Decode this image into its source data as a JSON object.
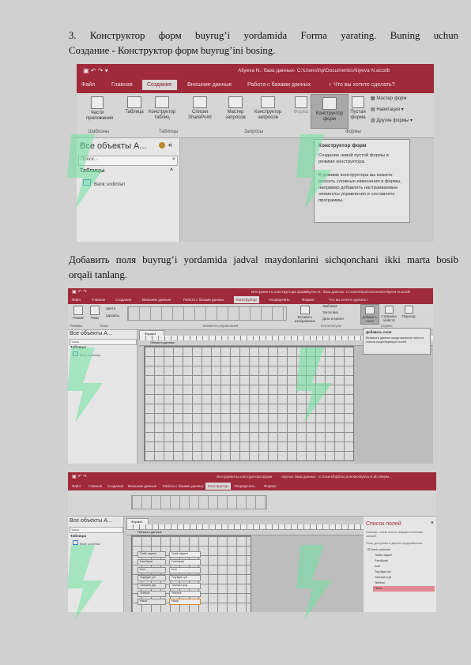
{
  "step": {
    "line1": "3.   Конструктор форм buyrug’i yordamida Forma yarating. Buning uchun",
    "line2": "Создание - Конструктор форм buyrug’ini bosing."
  },
  "step2": {
    "line1": "Добавить поля buyrug’i yordamida jadval maydonlarini sichqonchani ikki marta bosib",
    "line2": "orqali tanlang."
  },
  "shot1": {
    "title": "Aliyeva N.: база данных- C:\\Users\\hp\\Documents\\Aliyeva N.accdb",
    "tabs": [
      "Файл",
      "Главная",
      "Создание",
      "Внешние данные",
      "Работа с базами данных",
      "Что вы хотите сделать?"
    ],
    "buttons": {
      "parts": "Части приложения",
      "table": "Таблица",
      "table_design": "Конструктор таблиц",
      "sharepoint": "Списки SharePoint",
      "query_wizard": "Мастер запросов",
      "query_design": "Конструктор запросов",
      "form": "Форма",
      "form_design": "Конструктор форм",
      "blank_form": "Пустая форма",
      "form_wizard": "Мастер форм",
      "navigation": "Навигация",
      "other_forms": "Другие формы"
    },
    "groups": [
      "Шаблоны",
      "Таблицы",
      "Запросы",
      "Формы"
    ],
    "nav": {
      "header": "Все объекты А...",
      "search": "Поиск...",
      "section": "Таблицы",
      "item": "Bank sodimlari"
    },
    "tooltip": {
      "title": "Конструктор форм",
      "p1": "Создание новой пустой формы в режиме конструктора.",
      "p2": "В режиме конструктора вы можете вносить сложные изменения в формы, например добавлять настраиваемые элементы управления и составлять программы."
    }
  },
  "shot2": {
    "title": "Aliyeva N.: база данных- C:\\Users\\hp\\Documents\\Aliyeva N.accdb",
    "context": "Инструменты конструктора форм",
    "tabs": [
      "Файл",
      "Главная",
      "Создание",
      "Внешние данные",
      "Работа с базами данных",
      "Конструктор",
      "Упорядочить",
      "Формат",
      "Что вы хотите сделать?"
    ],
    "buttons": {
      "mode": "Режим",
      "themes": "Темы",
      "colors": "Цвета",
      "fonts": "Шрифты",
      "insert_image": "Вставить изображение",
      "logo": "Эмблема",
      "title_btn": "Заголовок",
      "datetime": "Дата и время",
      "add_fields": "Добавить поля",
      "prop_sheet": "Страница свойств",
      "tab_order": "Переход"
    },
    "groups": [
      "Режимы",
      "Темы",
      "Элементы управления",
      "Колонтитулы",
      "Сервис"
    ],
    "nav": {
      "header": "Все объекты А...",
      "search": "Поиск",
      "section": "Таблицы",
      "item": "Bank sodimlari"
    },
    "doc_tab": "Форма1",
    "section": "Область данных",
    "tooltip": {
      "title": "Добавить поля",
      "body": "Вставка в данное представление поля из списка существующих полей."
    }
  },
  "shot3": {
    "title": "Aliyeva: база данных - C:\\Users\\hp\\Documents\\Aliyeva N.db (Форм...",
    "context": "Инструменты конструктора форм",
    "tabs": [
      "Файл",
      "Главная",
      "Создание",
      "Внешние данные",
      "Работа с базами данных",
      "Конструктор",
      "Упорядочить",
      "Формат"
    ],
    "nav": {
      "header": "Все объекты А...",
      "search": "Поиск",
      "section": "Таблицы",
      "item": "Bank sodimlari"
    },
    "doc_tab": "Форма1",
    "section": "Область данных",
    "fields": [
      {
        "label": "Tartib raqami",
        "value": "Tartib raqami"
      },
      {
        "label": "Familiyasi",
        "value": "Familiyasi"
      },
      {
        "label": "Ismi",
        "value": "Ismi"
      },
      {
        "label": "Tug'ilgan yili",
        "value": "Tug'ilgan yili"
      },
      {
        "label": "Yashash joyi",
        "value": "Yashash joyi"
      },
      {
        "label": "Telefoni",
        "value": "Telefoni"
      },
      {
        "label": "Hisob",
        "value": "Hisob"
      }
    ],
    "panel": {
      "title": "Список полей",
      "hint": "Показать только поля в текущем источнике записей",
      "table_caption": "Поля, доступные в данном представлении:",
      "table": "Bank sodimlari",
      "items": [
        "Tartib raqami",
        "Familiyasi",
        "Ismi",
        "Tug'ilgan yili",
        "Yashash joyi",
        "Telefoni",
        "Hisob"
      ]
    }
  },
  "colors": {
    "access_red": "#9e2a3a",
    "page": "#d0d0d0",
    "watermark": "#6fe3a0"
  }
}
